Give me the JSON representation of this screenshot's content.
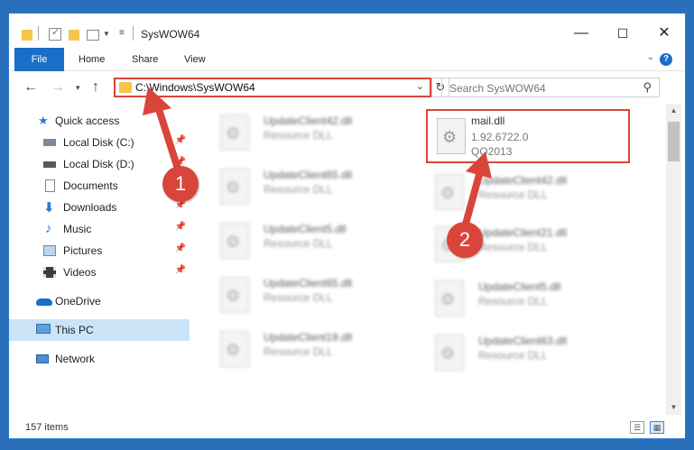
{
  "window": {
    "title": "SysWOW64"
  },
  "window_controls": {
    "minimize": "—",
    "maximize": "☐",
    "close": "✕"
  },
  "ribbon": {
    "tabs": [
      "File",
      "Home",
      "Share",
      "View"
    ],
    "help": "?"
  },
  "address": {
    "path": "C:\\Windows\\SysWOW64",
    "search_placeholder": "Search SysWOW64"
  },
  "nav": {
    "items": [
      {
        "label": "Quick access",
        "icon": "star-icon",
        "pinned": false
      },
      {
        "label": "Local Disk (C:)",
        "icon": "drive-icon",
        "pinned": true
      },
      {
        "label": "Local Disk (D:)",
        "icon": "drive-icon",
        "pinned": true
      },
      {
        "label": "Documents",
        "icon": "document-icon",
        "pinned": true
      },
      {
        "label": "Downloads",
        "icon": "download-icon",
        "pinned": true
      },
      {
        "label": "Music",
        "icon": "music-icon",
        "pinned": true
      },
      {
        "label": "Pictures",
        "icon": "pictures-icon",
        "pinned": true
      },
      {
        "label": "Videos",
        "icon": "video-icon",
        "pinned": true
      },
      {
        "label": "OneDrive",
        "icon": "cloud-icon",
        "pinned": false
      },
      {
        "label": "This PC",
        "icon": "computer-icon",
        "pinned": false,
        "selected": true
      },
      {
        "label": "Network",
        "icon": "network-icon",
        "pinned": false
      }
    ]
  },
  "files": {
    "highlighted": {
      "name": "mail.dll",
      "version": "1.92.6722.0",
      "product": "QQ2013"
    },
    "left_column": [
      {
        "name": "UpdateClient42.dll",
        "type": "Resource DLL"
      },
      {
        "name": "UpdateClient65.dll",
        "type": "Resource DLL"
      },
      {
        "name": "UpdateClient5.dll",
        "type": "Resource DLL"
      },
      {
        "name": "UpdateClient65.dll",
        "type": "Resource DLL"
      },
      {
        "name": "UpdateClient19.dll",
        "type": "Resource DLL"
      }
    ],
    "right_column": [
      {
        "name": "UpdateClient42.dll",
        "type": "Resource DLL"
      },
      {
        "name": "UpdateClient21.dll",
        "type": "Resource DLL"
      },
      {
        "name": "UpdateClient5.dll",
        "type": "Resource DLL"
      },
      {
        "name": "UpdateClient63.dll",
        "type": "Resource DLL"
      }
    ]
  },
  "status": {
    "item_count": "157 items"
  },
  "callouts": {
    "step1": "1",
    "step2": "2"
  },
  "colors": {
    "accent": "#1a6ec7",
    "highlight": "#d9453a",
    "selection": "#cce4f7"
  }
}
